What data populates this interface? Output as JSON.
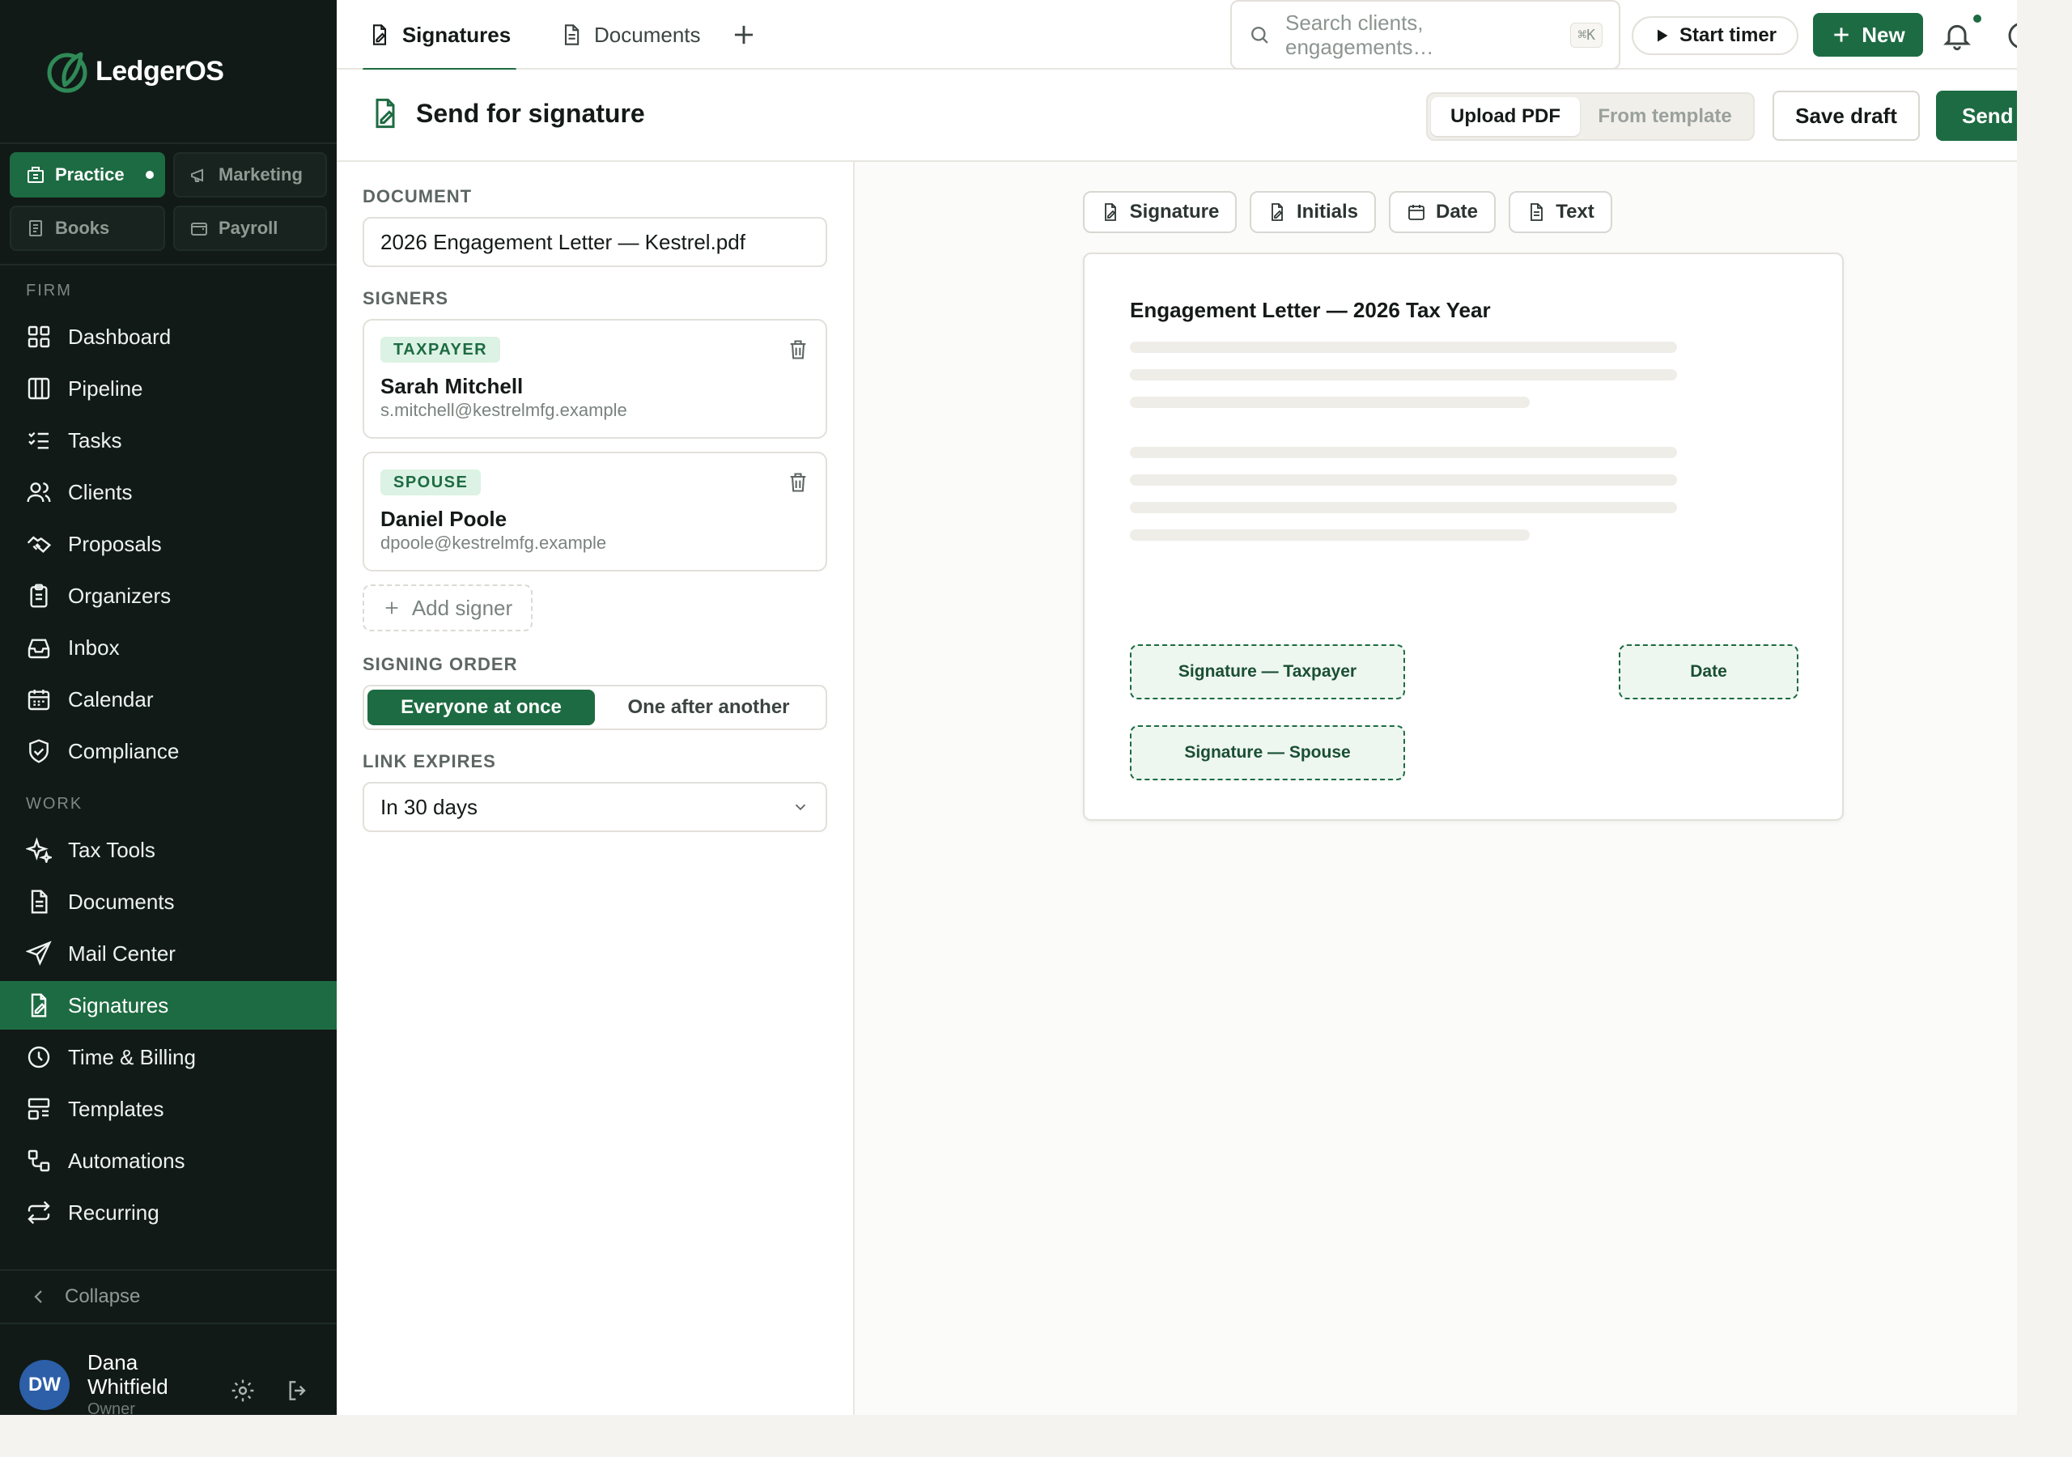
{
  "app": {
    "name": "LedgerOS"
  },
  "modules": [
    {
      "label": "Practice",
      "active": true
    },
    {
      "label": "Marketing"
    },
    {
      "label": "Books"
    },
    {
      "label": "Payroll"
    }
  ],
  "nav": {
    "firm_label": "FIRM",
    "work_label": "WORK",
    "firm_items": [
      {
        "label": "Dashboard",
        "icon": "grid-icon"
      },
      {
        "label": "Pipeline",
        "icon": "columns-icon"
      },
      {
        "label": "Tasks",
        "icon": "checklist-icon"
      },
      {
        "label": "Clients",
        "icon": "users-icon"
      },
      {
        "label": "Proposals",
        "icon": "handshake-icon"
      },
      {
        "label": "Organizers",
        "icon": "clipboard-icon"
      },
      {
        "label": "Inbox",
        "icon": "inbox-icon"
      },
      {
        "label": "Calendar",
        "icon": "calendar-icon"
      },
      {
        "label": "Compliance",
        "icon": "shield-check-icon"
      }
    ],
    "work_items": [
      {
        "label": "Tax Tools",
        "icon": "sparkle-icon"
      },
      {
        "label": "Documents",
        "icon": "document-icon"
      },
      {
        "label": "Mail Center",
        "icon": "send-icon"
      },
      {
        "label": "Signatures",
        "icon": "signature-icon",
        "active": true
      },
      {
        "label": "Time & Billing",
        "icon": "clock-icon"
      },
      {
        "label": "Templates",
        "icon": "layout-icon"
      },
      {
        "label": "Automations",
        "icon": "workflow-icon"
      },
      {
        "label": "Recurring",
        "icon": "repeat-icon"
      }
    ],
    "collapse_label": "Collapse"
  },
  "user": {
    "initials": "DW",
    "name": "Dana Whitfield",
    "role": "Owner"
  },
  "topbar": {
    "tabs": [
      {
        "label": "Signatures",
        "active": true
      },
      {
        "label": "Documents"
      }
    ],
    "search_placeholder": "Search clients, engagements…",
    "search_shortcut": "⌘K",
    "timer_label": "Start timer",
    "new_label": "New"
  },
  "header": {
    "title": "Send for signature",
    "source_options": [
      "Upload PDF",
      "From template"
    ],
    "source_selected": "Upload PDF",
    "save_draft_label": "Save draft",
    "send_label": "Send"
  },
  "form": {
    "document_label": "DOCUMENT",
    "document_value": "2026 Engagement Letter — Kestrel.pdf",
    "signers_label": "SIGNERS",
    "signers": [
      {
        "role": "TAXPAYER",
        "name": "Sarah Mitchell",
        "email": "s.mitchell@kestrelmfg.example"
      },
      {
        "role": "SPOUSE",
        "name": "Daniel Poole",
        "email": "dpoole@kestrelmfg.example"
      }
    ],
    "add_signer_label": "Add signer",
    "order_label": "SIGNING ORDER",
    "order_options": [
      "Everyone at once",
      "One after another"
    ],
    "order_selected": "Everyone at once",
    "expires_label": "LINK EXPIRES",
    "expires_value": "In 30 days"
  },
  "preview": {
    "tools": [
      {
        "label": "Signature",
        "icon": "signature-icon"
      },
      {
        "label": "Initials",
        "icon": "signature-icon"
      },
      {
        "label": "Date",
        "icon": "calendar-icon"
      },
      {
        "label": "Text",
        "icon": "document-icon"
      }
    ],
    "doc_title": "Engagement Letter — 2026 Tax Year",
    "fields": [
      "Signature — Taxpayer",
      "Date",
      "Signature — Spouse"
    ]
  },
  "colors": {
    "accent": "#1d6b42",
    "sidebar": "#111a17",
    "avatar": "#2c5fa8"
  }
}
